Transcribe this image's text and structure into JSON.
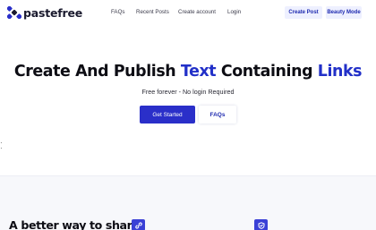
{
  "brand": {
    "name": "pastefree",
    "accent": "#2a2fc9"
  },
  "nav": {
    "links": [
      "FAQs",
      "Recent Posts",
      "Create account",
      "Login"
    ],
    "create_post": "Create Post",
    "beauty_mode": "Beauty Mode"
  },
  "hero": {
    "title_start": "Create And Publish ",
    "title_accent_1": "Text",
    "title_mid": " Containing ",
    "title_accent_2": "Links",
    "subtitle": "Free forever - No login Required",
    "primary_button": "Get Started",
    "secondary_button": "FAQs"
  },
  "section": {
    "title": "A better way to share",
    "icons": [
      "link-icon",
      "shield-icon"
    ]
  }
}
